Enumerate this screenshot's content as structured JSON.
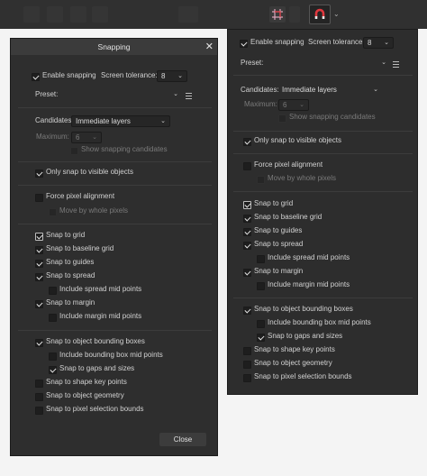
{
  "dialog": {
    "title": "Snapping",
    "close_glyph": "✕",
    "enable_snapping": "Enable snapping",
    "screen_tolerance_label": "Screen tolerance:",
    "screen_tolerance_value": "8",
    "preset_label": "Preset:",
    "candidates_label": "Candidates:",
    "candidates_value": "Immediate layers",
    "maximum_label": "Maximum:",
    "maximum_value": "6",
    "show_candidates": "Show snapping candidates",
    "only_visible": "Only snap to visible objects",
    "force_pixel": "Force pixel alignment",
    "move_whole_pixels": "Move by whole pixels",
    "snap_grid": "Snap to grid",
    "snap_baseline": "Snap to baseline grid",
    "snap_guides": "Snap to guides",
    "snap_spread": "Snap to spread",
    "include_spread_mid": "Include spread mid points",
    "snap_margin": "Snap to margin",
    "include_margin_mid": "Include margin mid points",
    "snap_bounding": "Snap to object bounding boxes",
    "include_bbox_mid": "Include bounding box mid points",
    "snap_gaps": "Snap to gaps and sizes",
    "snap_shape_key": "Snap to shape key points",
    "snap_geometry": "Snap to object geometry",
    "snap_pixel_bounds": "Snap to pixel selection bounds",
    "close_button": "Close"
  },
  "popover": {
    "enable_snapping": "Enable snapping",
    "screen_tolerance_label": "Screen tolerance:",
    "screen_tolerance_value": "8",
    "preset_label": "Preset:",
    "candidates_label": "Candidates:",
    "candidates_value": "Immediate layers",
    "maximum_label": "Maximum:",
    "maximum_value": "6",
    "show_candidates": "Show snapping candidates",
    "only_visible": "Only snap to visible objects",
    "force_pixel": "Force pixel alignment",
    "move_whole_pixels": "Move by whole pixels",
    "snap_grid": "Snap to grid",
    "snap_baseline": "Snap to baseline grid",
    "snap_guides": "Snap to guides",
    "snap_spread": "Snap to spread",
    "include_spread_mid": "Include spread mid points",
    "snap_margin": "Snap to margin",
    "include_margin_mid": "Include margin mid points",
    "snap_bounding": "Snap to object bounding boxes",
    "include_bbox_mid": "Include bounding box mid points",
    "snap_gaps": "Snap to gaps and sizes",
    "snap_shape_key": "Snap to shape key points",
    "snap_geometry": "Snap to object geometry",
    "snap_pixel_bounds": "Snap to pixel selection bounds"
  },
  "icons": {
    "dropdown": "chevron-down-icon",
    "menu": "hamburger-menu-icon",
    "snapping": "magnet-icon",
    "grid": "grid-icon"
  },
  "colors": {
    "panel_bg": "#2d2d2d",
    "toolbar_bg": "#303030",
    "magnet_red": "#e0383e",
    "grid_icon_pink": "#d9a3b8"
  }
}
